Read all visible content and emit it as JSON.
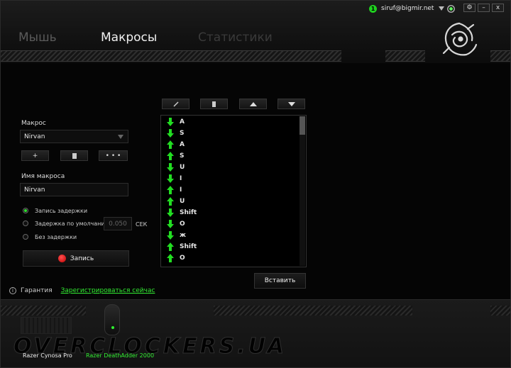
{
  "header": {
    "badge_count": "1",
    "user_email": "siruf@bigmir.net",
    "window_buttons": {
      "settings": "⚙",
      "minimize": "–",
      "close": "x"
    },
    "tabs": [
      {
        "label": "Мышь",
        "active": false
      },
      {
        "label": "Макросы",
        "active": true
      },
      {
        "label": "Статистики",
        "active": false
      }
    ]
  },
  "macro_panel": {
    "macro_label": "Макрос",
    "macro_selected": "Nirvan",
    "add_button": "+",
    "delete_button": "🗑",
    "more_button": "• • •",
    "name_label": "Имя макроса",
    "name_value": "Nirvan",
    "delay_options": [
      {
        "label": "Запись задержки",
        "selected": true
      },
      {
        "label": "Задержка по умолчанию",
        "selected": false
      },
      {
        "label": "Без задержки",
        "selected": false
      }
    ],
    "default_delay_value": "0.050",
    "delay_unit": "СЕК",
    "record_button": "Запись"
  },
  "warranty": {
    "label": "Гарантия",
    "register_link": "Зарегистрироваться сейчас"
  },
  "events": {
    "insert_button": "Вставить",
    "items": [
      {
        "dir": "down",
        "key": "A"
      },
      {
        "dir": "down",
        "key": "S"
      },
      {
        "dir": "up",
        "key": "A"
      },
      {
        "dir": "up",
        "key": "S"
      },
      {
        "dir": "down",
        "key": "U"
      },
      {
        "dir": "down",
        "key": "I"
      },
      {
        "dir": "up",
        "key": "I"
      },
      {
        "dir": "up",
        "key": "U"
      },
      {
        "dir": "down",
        "key": "Shift"
      },
      {
        "dir": "down",
        "key": "O"
      },
      {
        "dir": "down",
        "key": "ж"
      },
      {
        "dir": "up",
        "key": "Shift"
      },
      {
        "dir": "up",
        "key": "O"
      }
    ]
  },
  "footer": {
    "devices": [
      {
        "name": "Razer Cynosa Pro",
        "active": false
      },
      {
        "name": "Razer DeathAdder 2000",
        "active": true
      }
    ]
  },
  "colors": {
    "accent": "#33ee33",
    "record": "#e02020"
  },
  "watermark": "OVERCLOCKERS.UA"
}
